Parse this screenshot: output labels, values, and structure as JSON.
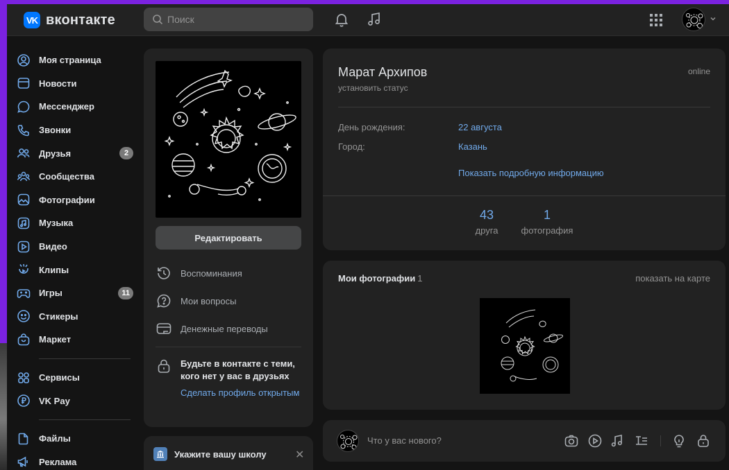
{
  "colors": {
    "accent_link": "#71aaeb",
    "brand": "#0077ff",
    "background": "#141414",
    "card": "#222222",
    "purple_frame": "#7b22e0"
  },
  "header": {
    "logo_badge": "VK",
    "logo_text": "вконтакте",
    "search_placeholder": "Поиск",
    "icons": [
      "bell-icon",
      "music-icon",
      "apps-grid-icon",
      "avatar",
      "chevron-down-icon"
    ]
  },
  "sidebar": {
    "items": [
      {
        "label": "Моя страница",
        "icon": "user-circle-icon"
      },
      {
        "label": "Новости",
        "icon": "news-icon"
      },
      {
        "label": "Мессенджер",
        "icon": "message-icon"
      },
      {
        "label": "Звонки",
        "icon": "phone-icon"
      },
      {
        "label": "Друзья",
        "icon": "friends-icon",
        "count": "2"
      },
      {
        "label": "Сообщества",
        "icon": "communities-icon"
      },
      {
        "label": "Фотографии",
        "icon": "photo-icon"
      },
      {
        "label": "Музыка",
        "icon": "music-icon"
      },
      {
        "label": "Видео",
        "icon": "video-icon"
      },
      {
        "label": "Клипы",
        "icon": "clips-icon"
      },
      {
        "label": "Игры",
        "icon": "gamepad-icon",
        "count": "11"
      },
      {
        "label": "Стикеры",
        "icon": "smile-icon"
      },
      {
        "label": "Маркет",
        "icon": "bag-icon"
      }
    ],
    "items2": [
      {
        "label": "Сервисы",
        "icon": "services-icon"
      },
      {
        "label": "VK Pay",
        "icon": "ruble-icon"
      }
    ],
    "items3": [
      {
        "label": "Файлы",
        "icon": "file-icon"
      },
      {
        "label": "Реклама",
        "icon": "megaphone-icon"
      }
    ]
  },
  "left_column": {
    "edit_button": "Редактировать",
    "menu": [
      {
        "label": "Воспоминания",
        "icon": "history-icon"
      },
      {
        "label": "Мои вопросы",
        "icon": "question-icon"
      },
      {
        "label": "Денежные переводы",
        "icon": "card-icon"
      }
    ],
    "privacy_text": "Будьте в контакте с теми, кого нет у вас в друзьях",
    "privacy_link": "Сделать профиль открытым",
    "school_text": "Укажите вашу школу",
    "school_close": "✕"
  },
  "profile": {
    "name": "Марат Архипов",
    "status_link": "установить статус",
    "online": "online",
    "fields": [
      {
        "key": "День рождения:",
        "value": "22 августа"
      },
      {
        "key": "Город:",
        "value": "Казань"
      }
    ],
    "more_link": "Показать подробную информацию",
    "stats": [
      {
        "number": "43",
        "label": "друга"
      },
      {
        "number": "1",
        "label": "фотография"
      }
    ]
  },
  "photos": {
    "title": "Мои фотографии",
    "count": "1",
    "map_link": "показать на карте"
  },
  "post": {
    "placeholder": "Что у вас нового?",
    "tools": [
      "camera-icon",
      "play-icon",
      "music-icon",
      "article-icon",
      "lightbulb-icon",
      "lock-icon"
    ]
  }
}
